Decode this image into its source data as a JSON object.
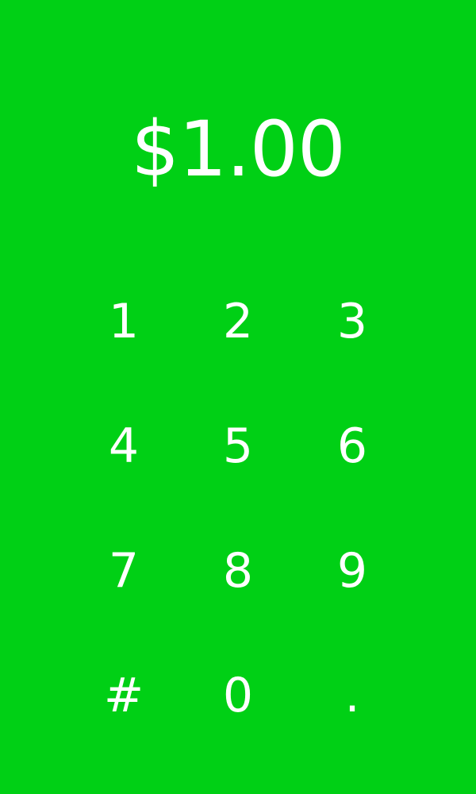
{
  "theme": {
    "background": "#00d015",
    "text_color": "#ffffff"
  },
  "amount_display": "$1.00",
  "keypad": {
    "keys": [
      "1",
      "2",
      "3",
      "4",
      "5",
      "6",
      "7",
      "8",
      "9",
      "#",
      "0",
      "."
    ]
  }
}
